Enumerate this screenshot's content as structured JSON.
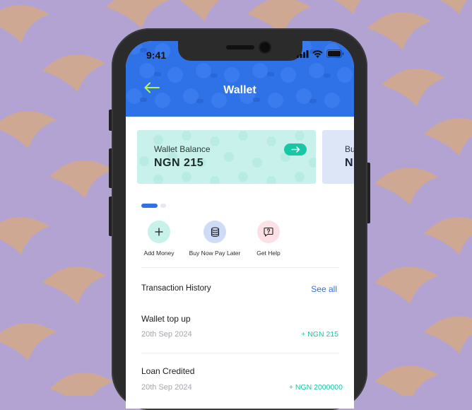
{
  "status_bar": {
    "time": "9:41"
  },
  "header": {
    "title": "Wallet"
  },
  "cards": [
    {
      "label": "Wallet Balance",
      "value": "NGN 215"
    },
    {
      "label": "Bu",
      "value": "N"
    }
  ],
  "actions": [
    {
      "label": "Add Money",
      "icon": "plus-icon"
    },
    {
      "label": "Buy Now Pay Later",
      "icon": "coins-icon"
    },
    {
      "label": "Get Help",
      "icon": "help-icon"
    }
  ],
  "transactions": {
    "title": "Transaction History",
    "see_all": "See all",
    "items": [
      {
        "title": "Wallet top up",
        "date": "20th Sep 2024",
        "amount": "+ NGN 215"
      },
      {
        "title": "Loan Credited",
        "date": "20th Sep 2024",
        "amount": "+ NGN 2000000"
      }
    ]
  },
  "colors": {
    "background": "#b3a3d3",
    "pattern": "#d1a98b",
    "header": "#2f71e6",
    "accent": "#19c7a6",
    "back_arrow": "#b9f25a"
  }
}
